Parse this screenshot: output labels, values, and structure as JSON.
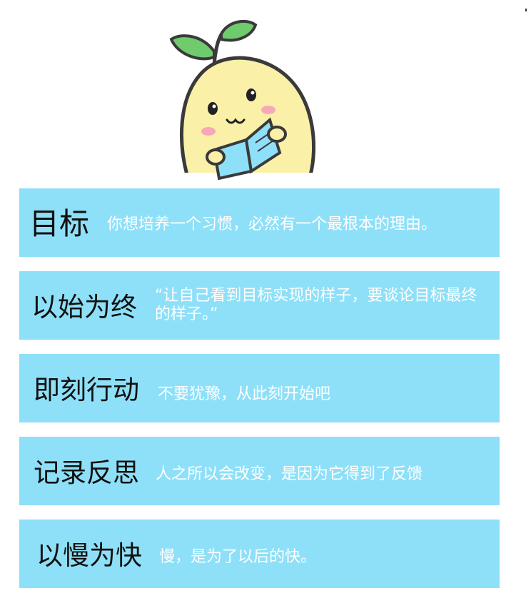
{
  "mascot": {
    "icon": "potato-reading-book-icon",
    "body_color": "#fbf0a8",
    "leaf_color": "#6fcb6e",
    "book_color": "#8ee0f8",
    "cheek_color": "#f7a8b8"
  },
  "colors": {
    "card_background": "#8ee0f8",
    "title_text": "#111111",
    "body_text": "#ffffff"
  },
  "cards": [
    {
      "title": "目标",
      "text": "你想培养一个习惯，必然有一个最根本的理由。"
    },
    {
      "title": "以始为终",
      "text": "“让自己看到目标实现的样子，要谈论目标最终的样子。”"
    },
    {
      "title": "即刻行动",
      "text": "不要犹豫，从此刻开始吧"
    },
    {
      "title": "记录反思",
      "text": "人之所以会改变，是因为它得到了反馈"
    },
    {
      "title": "以慢为快",
      "text": "慢，是为了以后的快。"
    }
  ]
}
